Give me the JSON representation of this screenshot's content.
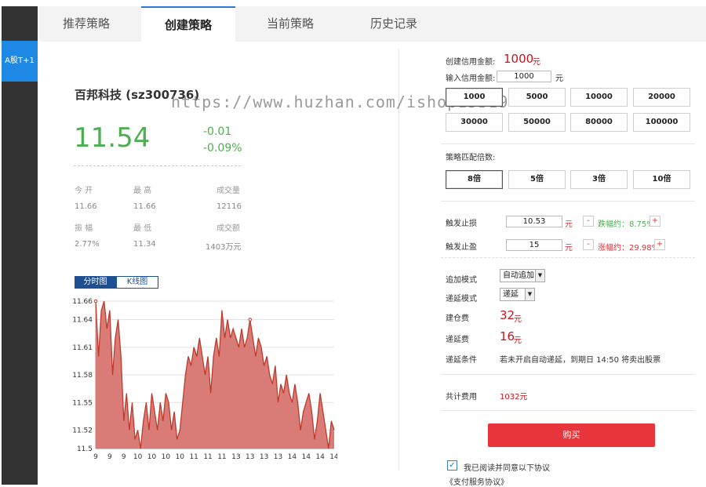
{
  "sidebar": {
    "active_item": "A股T+1"
  },
  "tabs": [
    "推荐策略",
    "创建策略",
    "当前策略",
    "历史记录"
  ],
  "stock": {
    "name": "百邦科技 (sz300736)",
    "price": "11.54",
    "change": "-0.01",
    "change_pct": "-0.09%",
    "quote_labels": [
      "今 开",
      "最 高",
      "成交量",
      "振 幅",
      "最 低",
      "成交额"
    ],
    "quote_values": [
      "11.66",
      "11.66",
      "12116",
      "2.77%",
      "11.34",
      "1403万元"
    ]
  },
  "chart_tabs": [
    "分时图",
    "K线图"
  ],
  "chart_data": {
    "type": "area",
    "title": "",
    "xlabel": "",
    "ylabel": "",
    "ylim": [
      11.5,
      11.66
    ],
    "y_ticks": [
      "11.66",
      "11.64",
      "11.61",
      "11.58",
      "11.55",
      "11.52",
      "11.5"
    ],
    "x_ticks": [
      "9",
      "9",
      "9",
      "10",
      "10",
      "10",
      "10",
      "11",
      "11",
      "11",
      "13",
      "13",
      "13",
      "13",
      "14",
      "14",
      "14",
      "14"
    ],
    "grid": true,
    "series": [
      {
        "values": [
          11.66,
          11.6,
          11.65,
          11.66,
          11.63,
          11.65,
          11.58,
          11.62,
          11.64,
          11.6,
          11.53,
          11.56,
          11.52,
          11.55,
          11.51,
          11.52,
          11.5,
          11.53,
          11.55,
          11.52,
          11.56,
          11.54,
          11.52,
          11.55,
          11.53,
          11.56,
          11.55,
          11.52,
          11.54,
          11.51,
          11.52,
          11.55,
          11.58,
          11.6,
          11.59,
          11.61,
          11.6,
          11.62,
          11.6,
          11.58,
          11.6,
          11.56,
          11.6,
          11.62,
          11.6,
          11.65,
          11.62,
          11.64,
          11.62,
          11.63,
          11.62,
          11.61,
          11.63,
          11.61,
          11.62,
          11.64,
          11.62,
          11.6,
          11.62,
          11.61,
          11.59,
          11.6,
          11.58,
          11.57,
          11.59,
          11.55,
          11.57,
          11.56,
          11.58,
          11.56,
          11.55,
          11.57,
          11.55,
          11.52,
          11.54,
          11.55,
          11.56,
          11.54,
          11.51,
          11.53,
          11.56,
          11.54,
          11.52,
          11.5,
          11.53,
          11.52
        ],
        "color": "#c0392b",
        "fill": "#d77571"
      }
    ]
  },
  "credit": {
    "label": "创建信用金额:",
    "amount": "1000",
    "unit": "元",
    "input_label": "输入信用金额:",
    "input_value": "1000",
    "input_unit": "元",
    "options": [
      "1000",
      "5000",
      "10000",
      "20000",
      "30000",
      "50000",
      "80000",
      "100000"
    ],
    "selected": "1000"
  },
  "multiplier": {
    "label": "策略匹配倍数:",
    "options": [
      "8倍",
      "5倍",
      "3倍",
      "10倍"
    ],
    "selected": "8倍"
  },
  "stop_loss": {
    "label": "触发止损",
    "value": "10.53",
    "unit": "元",
    "minus": "-",
    "plus": "+",
    "hint": "跌幅约：8.75%"
  },
  "take_profit": {
    "label": "触发止盈",
    "value": "15",
    "unit": "元",
    "minus": "-",
    "plus": "+",
    "hint": "涨幅约：29.98%"
  },
  "add_mode": {
    "label": "追加模式",
    "value": "自动追加"
  },
  "extend_mode": {
    "label": "递延模式",
    "value": "递延"
  },
  "build_fee": {
    "label": "建仓费",
    "value": "32",
    "unit": "元"
  },
  "extend_fee": {
    "label": "递延费",
    "value": "16",
    "unit": "元"
  },
  "extend_cond": {
    "label": "递延条件",
    "text": "若未开启自动递延，到期日 14:50 将卖出股票"
  },
  "total": {
    "label": "共计费用",
    "value": "1032元"
  },
  "buy_label": "购买",
  "agree_label": "我已阅读并同意以下协议",
  "agreement_link": "《支付服务协议》",
  "watermark": "https://www.huzhan.com/ishop15319",
  "colors": {
    "up": "#d9363e",
    "down": "#4cb050",
    "accent": "#1e88e5",
    "buy": "#e8353b"
  }
}
